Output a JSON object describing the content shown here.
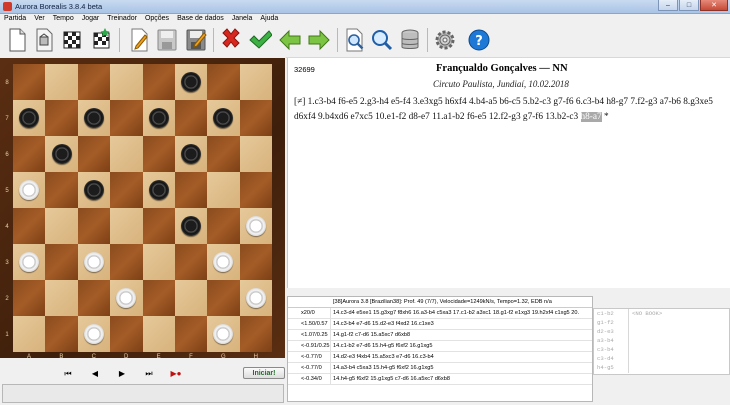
{
  "window": {
    "title": "Aurora Borealis 3.8.4 beta",
    "buttons": [
      "–",
      "□",
      "✕"
    ]
  },
  "menu": [
    "Partida",
    "Ver",
    "Tempo",
    "Jogar",
    "Treinador",
    "Opções",
    "Base de dados",
    "Janela",
    "Ajuda"
  ],
  "toolbar": [
    {
      "name": "new-document-icon"
    },
    {
      "name": "edit-position-icon"
    },
    {
      "name": "board-icon"
    },
    {
      "name": "board-star-icon"
    },
    {
      "name": "pencil-icon"
    },
    {
      "name": "save-icon"
    },
    {
      "name": "save-as-icon"
    },
    {
      "name": "delete-icon"
    },
    {
      "name": "confirm-icon"
    },
    {
      "name": "arrow-back-icon"
    },
    {
      "name": "arrow-forward-icon"
    },
    {
      "name": "search-document-icon"
    },
    {
      "name": "search-icon"
    },
    {
      "name": "database-icon"
    },
    {
      "name": "gear-icon"
    },
    {
      "name": "help-icon"
    }
  ],
  "board": {
    "ranks": [
      "8",
      "7",
      "6",
      "5",
      "4",
      "3",
      "2",
      "1"
    ],
    "files": [
      "A",
      "B",
      "C",
      "D",
      "E",
      "F",
      "G",
      "H"
    ],
    "pieces": [
      {
        "sq": "f8",
        "color": "black"
      },
      {
        "sq": "a7",
        "color": "black"
      },
      {
        "sq": "c7",
        "color": "black"
      },
      {
        "sq": "e7",
        "color": "black"
      },
      {
        "sq": "g7",
        "color": "black"
      },
      {
        "sq": "b6",
        "color": "black"
      },
      {
        "sq": "f6",
        "color": "black"
      },
      {
        "sq": "a5",
        "color": "white"
      },
      {
        "sq": "c5",
        "color": "black"
      },
      {
        "sq": "e5",
        "color": "black"
      },
      {
        "sq": "f4",
        "color": "black"
      },
      {
        "sq": "h4",
        "color": "white"
      },
      {
        "sq": "a3",
        "color": "white"
      },
      {
        "sq": "c3",
        "color": "white"
      },
      {
        "sq": "g3",
        "color": "white"
      },
      {
        "sq": "d2",
        "color": "white"
      },
      {
        "sq": "h2",
        "color": "white"
      },
      {
        "sq": "c1",
        "color": "white"
      },
      {
        "sq": "g1",
        "color": "white"
      }
    ]
  },
  "nav": {
    "buttons": [
      "⏮",
      "◀",
      "▶",
      "⏭",
      "▶●"
    ],
    "start_label": "Iniciar!"
  },
  "game": {
    "id": "32699",
    "players": "Françualdo Gonçalves — NN",
    "event": "Circuto Paulista, Jundiaí, 10.02.2018",
    "moves_before": "[≠] 1.c3-b4 f6-e5 2.g3-h4 e5-f4 3.e3xg5 h6xf4 4.b4-a5 b6-c5 5.b2-c3 g7-f6 6.c3-b4 h8-g7 7.f2-g3 a7-b6 8.g3xe5 d6xf4 9.b4xd6 e7xc5 10.e1-f2 d8-e7 11.a1-b2 f6-e5 12.f2-g3 g7-f6 13.b2-c3 ",
    "current_move": "h8-a7",
    "moves_after": " *"
  },
  "engine": {
    "header": "[38]Aurora 3.8 [Brazilian38]: Prof. 49 (7/7), Velocidade=1249kN/s, Tempo=1.32,  EDB n/a",
    "lines": [
      {
        "eval": "x20/0",
        "pv": "14.c3-d4 e5xe1 15.g3xg7 f8xh6 16.a3-b4 c5xa3 17.c1-b2 a3xc1 18.g1-f2 e1xg3 19.h2xf4 c1xg5 20."
      },
      {
        "eval": "<1.50/0.57",
        "pv": "14.c3-b4 e7-d6 15.d2-e3 f4xd2 16.c1xe3"
      },
      {
        "eval": "<1.07/0.25",
        "pv": "14.g1-f2 c7-d6 15.a5xc7 d6xb8"
      },
      {
        "eval": "<-0.91/0.25",
        "pv": "14.c1-b2 e7-d6 15.h4-g5 f6xf2 16.g1xg5"
      },
      {
        "eval": "<-0.77/0",
        "pv": "14.d2-e3 f4xb4 15.a5xc3 e7-d6 16.c3-b4"
      },
      {
        "eval": "<-0.77/0",
        "pv": "14.a3-b4 c5xa3 15.h4-g5 f6xf2 16.g1xg5"
      },
      {
        "eval": "<-0.34/0",
        "pv": "14.h4-g5 f6xf2 15.g1xg5 c7-d6 16.a5xc7 d6xb8"
      }
    ]
  },
  "book": {
    "moves": [
      "c1-b2",
      "g1-f2",
      "d2-e3",
      "a3-b4",
      "c3-b4",
      "c3-d4",
      "h4-g5"
    ],
    "label": "<NO BOOK>"
  }
}
